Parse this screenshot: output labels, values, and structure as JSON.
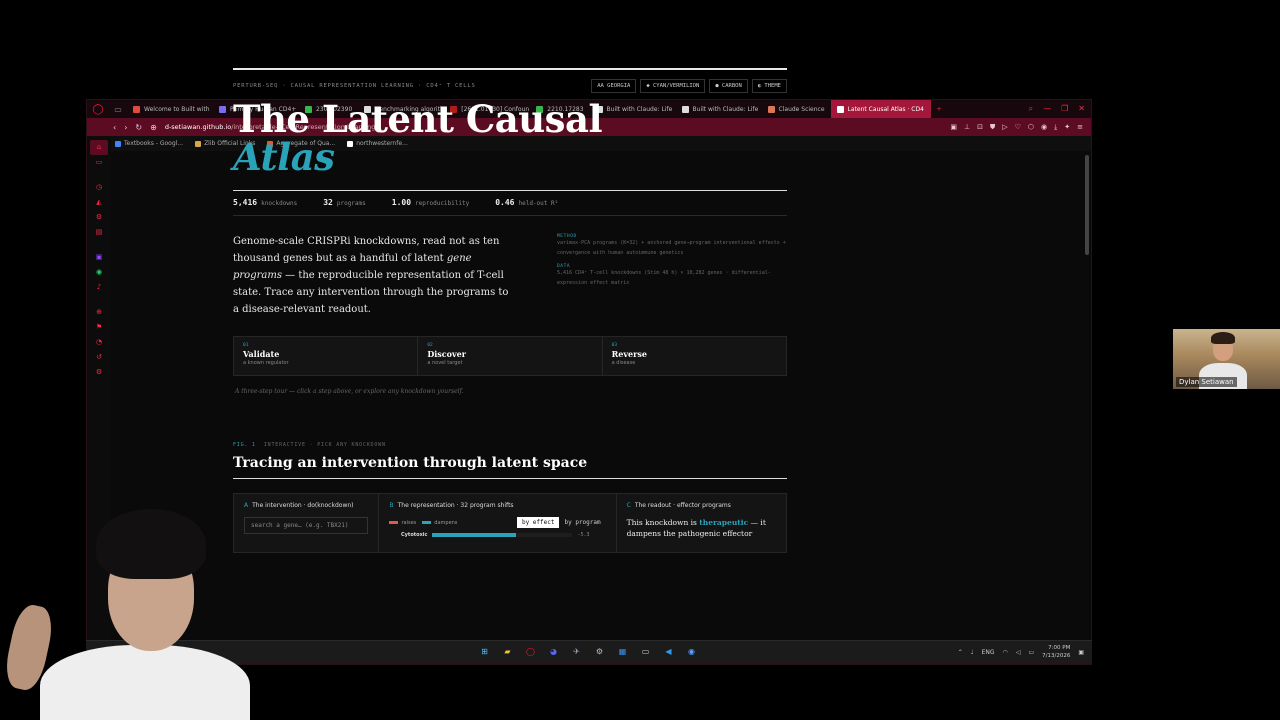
{
  "browser": {
    "tabs": [
      {
        "label": "Welcome to Built with",
        "color": "#e24a3a"
      },
      {
        "label": "Primary Human CD4+",
        "color": "#7a6cf0"
      },
      {
        "label": "2307.02390",
        "color": "#36b54a"
      },
      {
        "label": "Benchmarking algorith",
        "color": "#dddddd"
      },
      {
        "label": "[2601.01630] Confoun",
        "color": "#b31b1b"
      },
      {
        "label": "2210.17283",
        "color": "#36b54a"
      },
      {
        "label": "Built with Claude: Life",
        "color": "#dddddd"
      },
      {
        "label": "Built with Claude: Life",
        "color": "#dddddd"
      },
      {
        "label": "Claude Science",
        "color": "#d97757"
      },
      {
        "label": "Latent Causal Atlas · CD4",
        "color": "#ffffff",
        "active": true
      }
    ],
    "url_host": "d-setiawan.github.io",
    "url_path": "/interpretable-TCell-Representation-Learning/",
    "bookmarks": [
      {
        "label": "Textbooks - Googl...",
        "color": "#4285f4"
      },
      {
        "label": "Zlib Official Links",
        "color": "#d6a84a"
      },
      {
        "label": "Aggregate of Qua...",
        "color": "#e35b2b"
      },
      {
        "label": "northwesternfe...",
        "color": "#ffffff"
      }
    ]
  },
  "page": {
    "kicker": "PERTURB-SEQ · CAUSAL REPRESENTATION LEARNING · CD4⁺ T CELLS",
    "options": [
      "AA GEORGIA",
      "◆ CYAN/VERMILION",
      "● CARBON",
      "◐ THEME"
    ],
    "title_line1": "The Latent Causal",
    "title_line2": "Atlas",
    "stats": [
      {
        "value": "5,416",
        "label": "knockdowns"
      },
      {
        "value": "32",
        "label": "programs"
      },
      {
        "value": "1.00",
        "label": "reproducibility"
      },
      {
        "value": "0.46",
        "label": "held-out R²"
      }
    ],
    "intro_a": "Genome-scale CRISPRi knockdowns, read not as ten thousand genes but as a handful of latent ",
    "intro_em": "gene programs",
    "intro_b": " — the reproducible representation of T-cell state. Trace any intervention through the programs to a disease-relevant readout.",
    "method_label": "METHOD",
    "method_text": "varimax-PCA programs (K=32) + anchored gene→program interventional effects + convergence with human autoimmune genetics",
    "data_label": "DATA",
    "data_text": "5,416 CD4⁺ T-cell knockdowns (Stim 48 h) × 10,282 genes · differential-expression effect matrix",
    "steps": [
      {
        "num": "01",
        "title": "Validate",
        "sub": "a known regulator"
      },
      {
        "num": "02",
        "title": "Discover",
        "sub": "a novel target"
      },
      {
        "num": "03",
        "title": "Reverse",
        "sub": "a disease"
      }
    ],
    "tour": "A three-step tour — click a step above, or explore any knockdown yourself.",
    "fig_num": "FIG. 1",
    "fig_caption": "INTERACTIVE · PICK ANY KNOCKDOWN",
    "fig_title": "Tracing an intervention through latent space",
    "panel_a": {
      "letter": "A",
      "title": "The intervention · do(knockdown)",
      "placeholder": "search a gene… (e.g. TBX21)"
    },
    "panel_b": {
      "letter": "B",
      "title": "The representation · 32 program shifts",
      "legend_raises": "raises",
      "legend_dampens": "dampens",
      "toggle_on": "by effect",
      "toggle_off": "by program",
      "bar_label": "Cytotoxic",
      "bar_value": "-5.3",
      "bar_fraction": 0.6
    },
    "panel_c": {
      "letter": "C",
      "title": "The readout · effector programs",
      "text_a": "This knockdown is ",
      "text_hl": "therapeutic",
      "text_b": " — it dampens the pathogenic effector"
    }
  },
  "colors": {
    "accent": "#2aa2b8",
    "raises": "#e05a4a",
    "dampens": "#2aa2b8"
  },
  "taskbar": {
    "lang": "ENG",
    "time": "7:00 PM",
    "date": "7/13/2026"
  },
  "webcam": {
    "name": "Dylan Setiawan"
  }
}
